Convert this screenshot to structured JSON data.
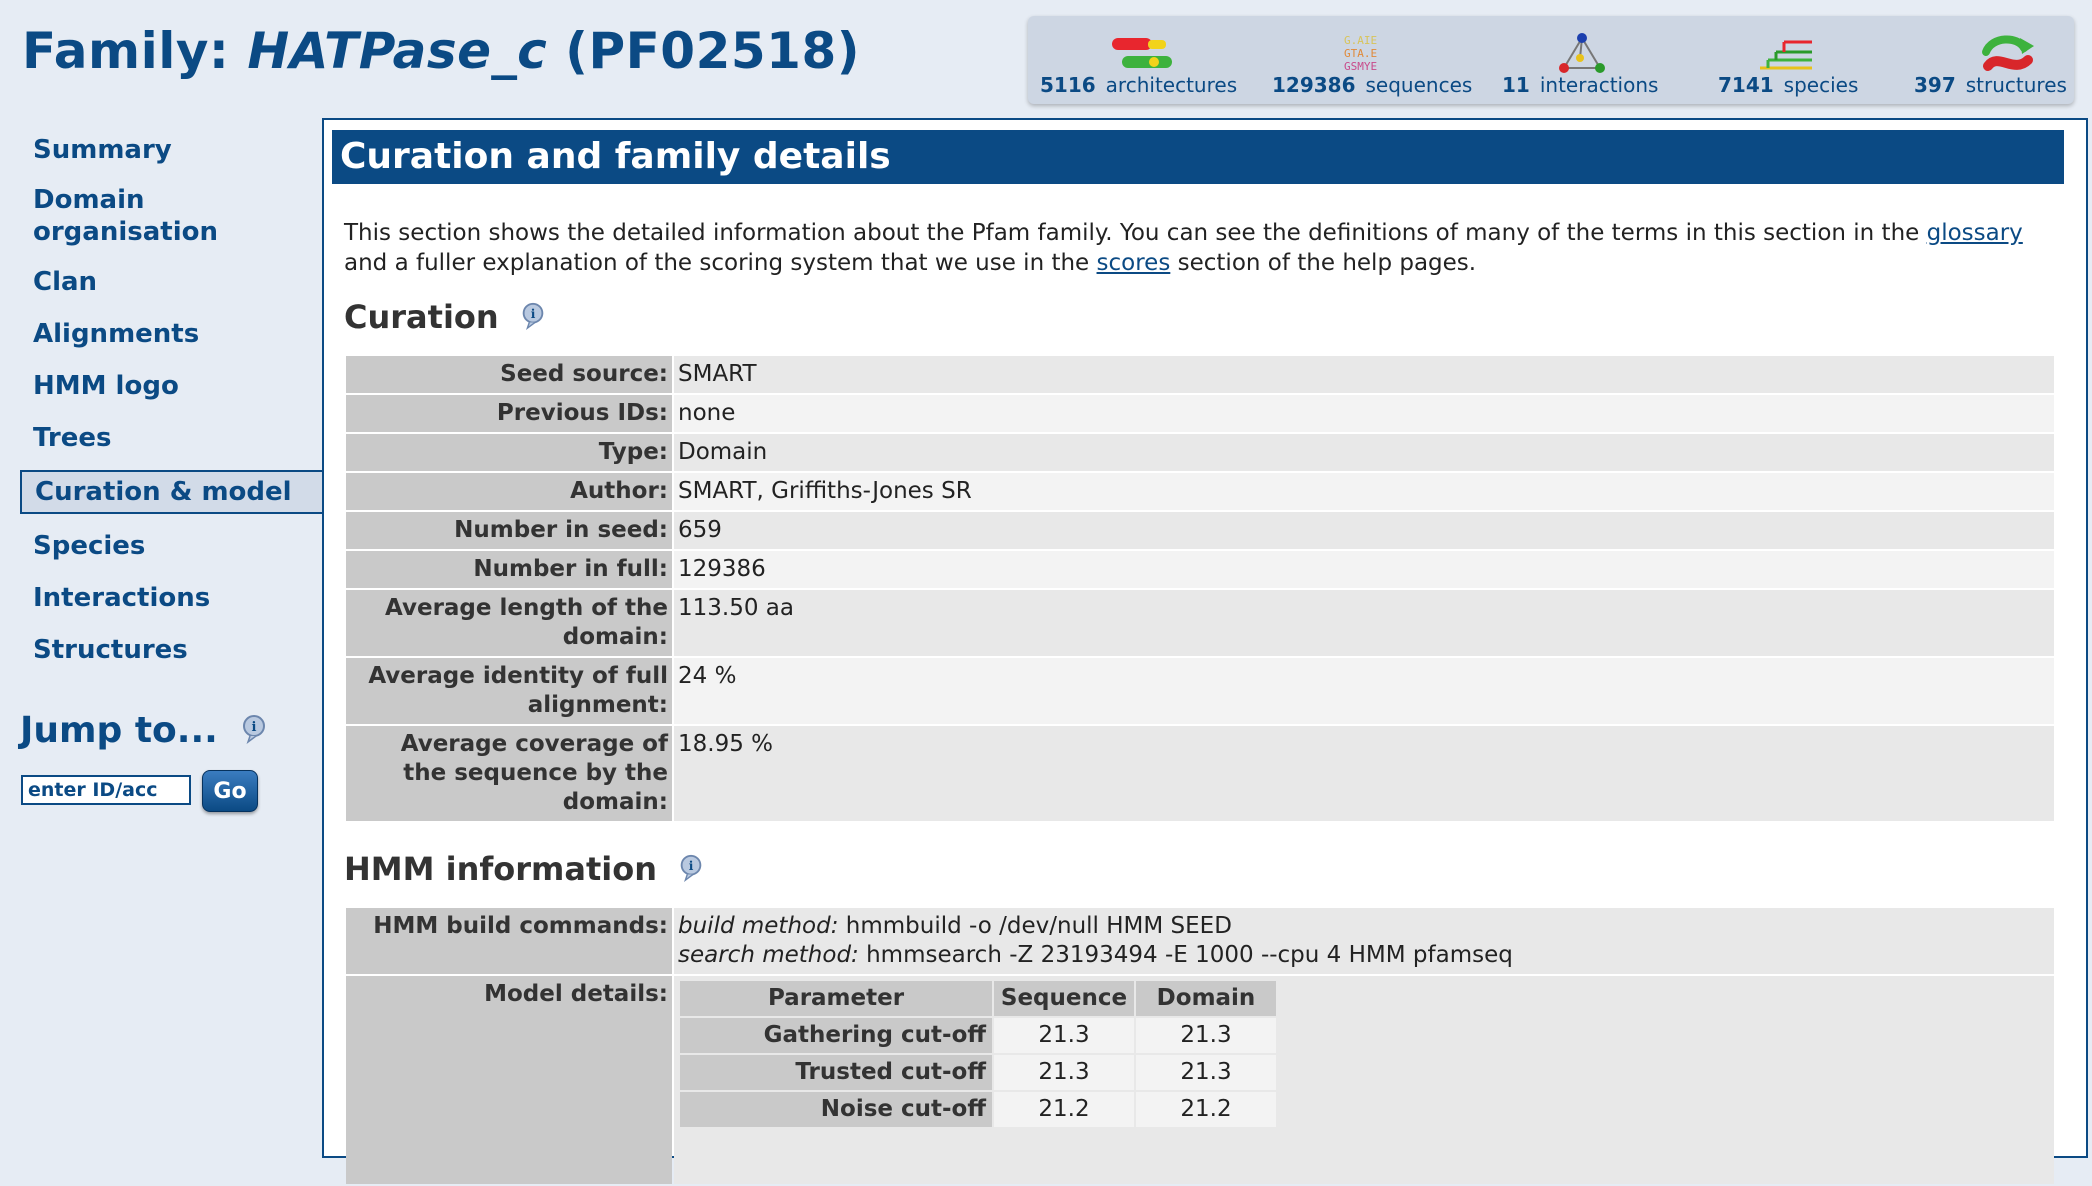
{
  "header": {
    "prefix": "Family: ",
    "family_name": "HATPase_c",
    "accession": " (PF02518)"
  },
  "stats": [
    {
      "count": "5116",
      "label": "architectures",
      "icon": "architectures-icon"
    },
    {
      "count": "129386",
      "label": "sequences",
      "icon": "sequences-icon"
    },
    {
      "count": "11",
      "label": "interactions",
      "icon": "interactions-icon"
    },
    {
      "count": "7141",
      "label": "species",
      "icon": "species-icon"
    },
    {
      "count": "397",
      "label": "structures",
      "icon": "structures-icon"
    }
  ],
  "sidebar": {
    "items": [
      {
        "label": "Summary"
      },
      {
        "label": "Domain organisation"
      },
      {
        "label": "Clan"
      },
      {
        "label": "Alignments"
      },
      {
        "label": "HMM logo"
      },
      {
        "label": "Trees"
      },
      {
        "label": "Curation & model"
      },
      {
        "label": "Species"
      },
      {
        "label": "Interactions"
      },
      {
        "label": "Structures"
      }
    ],
    "jump_title": "Jump to...",
    "jump_input_value": "enter ID/acc",
    "go_label": "Go"
  },
  "main": {
    "section_title": "Curation and family details",
    "intro_part1": "This section shows the detailed information about the Pfam family. You can see the definitions of many of the terms in this section in the ",
    "intro_link1": "glossary",
    "intro_part2": " and a fuller explanation of the scoring system that we use in the ",
    "intro_link2": "scores",
    "intro_part3": " section of the help pages.",
    "curation_heading": "Curation",
    "curation": {
      "seed_source_label": "Seed source:",
      "seed_source": "SMART",
      "previous_ids_label": "Previous IDs:",
      "previous_ids": "none",
      "type_label": "Type:",
      "type": "Domain",
      "author_label": "Author:",
      "author": "SMART, Griffiths-Jones SR",
      "num_seed_label": "Number in seed:",
      "num_seed": "659",
      "num_full_label": "Number in full:",
      "num_full": "129386",
      "avg_length_label": "Average length of the domain:",
      "avg_length": "113.50 aa",
      "avg_identity_label": "Average identity of full alignment:",
      "avg_identity": "24 %",
      "avg_coverage_label": "Average coverage of the sequence by the domain:",
      "avg_coverage": "18.95 %"
    },
    "hmm_heading": "HMM information",
    "hmm": {
      "build_commands_label": "HMM build commands:",
      "build_method_label": "build method:",
      "build_method": " hmmbuild -o /dev/null HMM SEED",
      "search_method_label": "search method:",
      "search_method": " hmmsearch -Z 23193494 -E 1000 --cpu 4 HMM pfamseq",
      "model_details_label": "Model details:",
      "model_table": {
        "headers": [
          "Parameter",
          "Sequence",
          "Domain"
        ],
        "rows": [
          {
            "param": "Gathering cut-off",
            "sequence": "21.3",
            "domain": "21.3"
          },
          {
            "param": "Trusted cut-off",
            "sequence": "21.3",
            "domain": "21.3"
          },
          {
            "param": "Noise cut-off",
            "sequence": "21.2",
            "domain": "21.2"
          }
        ]
      }
    }
  },
  "colors": {
    "brand_blue": "#0b4a84",
    "page_bg": "#e6ecf4",
    "header_cell": "#c9c9c9"
  }
}
